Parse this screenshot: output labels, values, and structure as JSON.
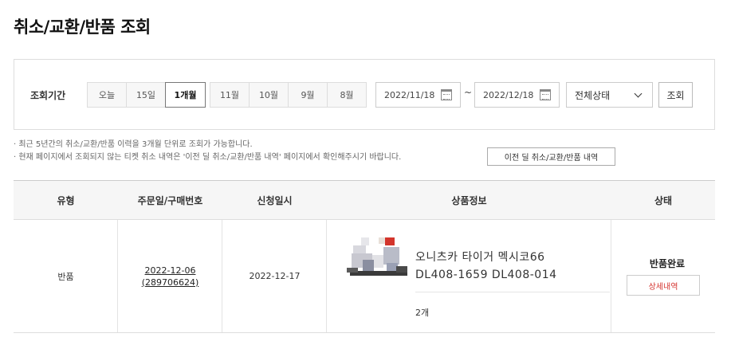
{
  "page": {
    "title": "취소/교환/반품 조회"
  },
  "filter": {
    "period_label": "조회기간",
    "quick_periods": [
      {
        "label": "오늘",
        "active": false
      },
      {
        "label": "15일",
        "active": false
      },
      {
        "label": "1개월",
        "active": true
      }
    ],
    "months": [
      "11월",
      "10월",
      "9월",
      "8월"
    ],
    "start_date": "2022/11/18",
    "separator": "~",
    "end_date": "2022/12/18",
    "status_selected": "전체상태",
    "search_label": "조회"
  },
  "notes": [
    "· 최근 5년간의 취소/교환/반품 이력을 3개월 단위로 조회가 가능합니다.",
    "· 현재 페이지에서 조회되지 않는 티켓 취소 내역은 '이전 딜 취소/교환/반품 내역' 페이지에서 확인해주시기 바랍니다."
  ],
  "history_button": "이전 딜 취소/교환/반품 내역",
  "table": {
    "headers": [
      "유형",
      "주문일/구매번호",
      "신청일시",
      "상품정보",
      "상태"
    ],
    "rows": [
      {
        "type": "반품",
        "order_date": "2022-12-06",
        "order_no": "(289706624)",
        "request_date": "2022-12-17",
        "product_line1": "오니츠카 타이거 멕시코66",
        "product_line2": "DL408-1659 DL408-014",
        "quantity": "2개",
        "status": "반품완료",
        "detail_label": "상세내역"
      }
    ]
  },
  "colors": {
    "accent_red": "#d4312c",
    "header_bg": "#f6f6f6"
  }
}
